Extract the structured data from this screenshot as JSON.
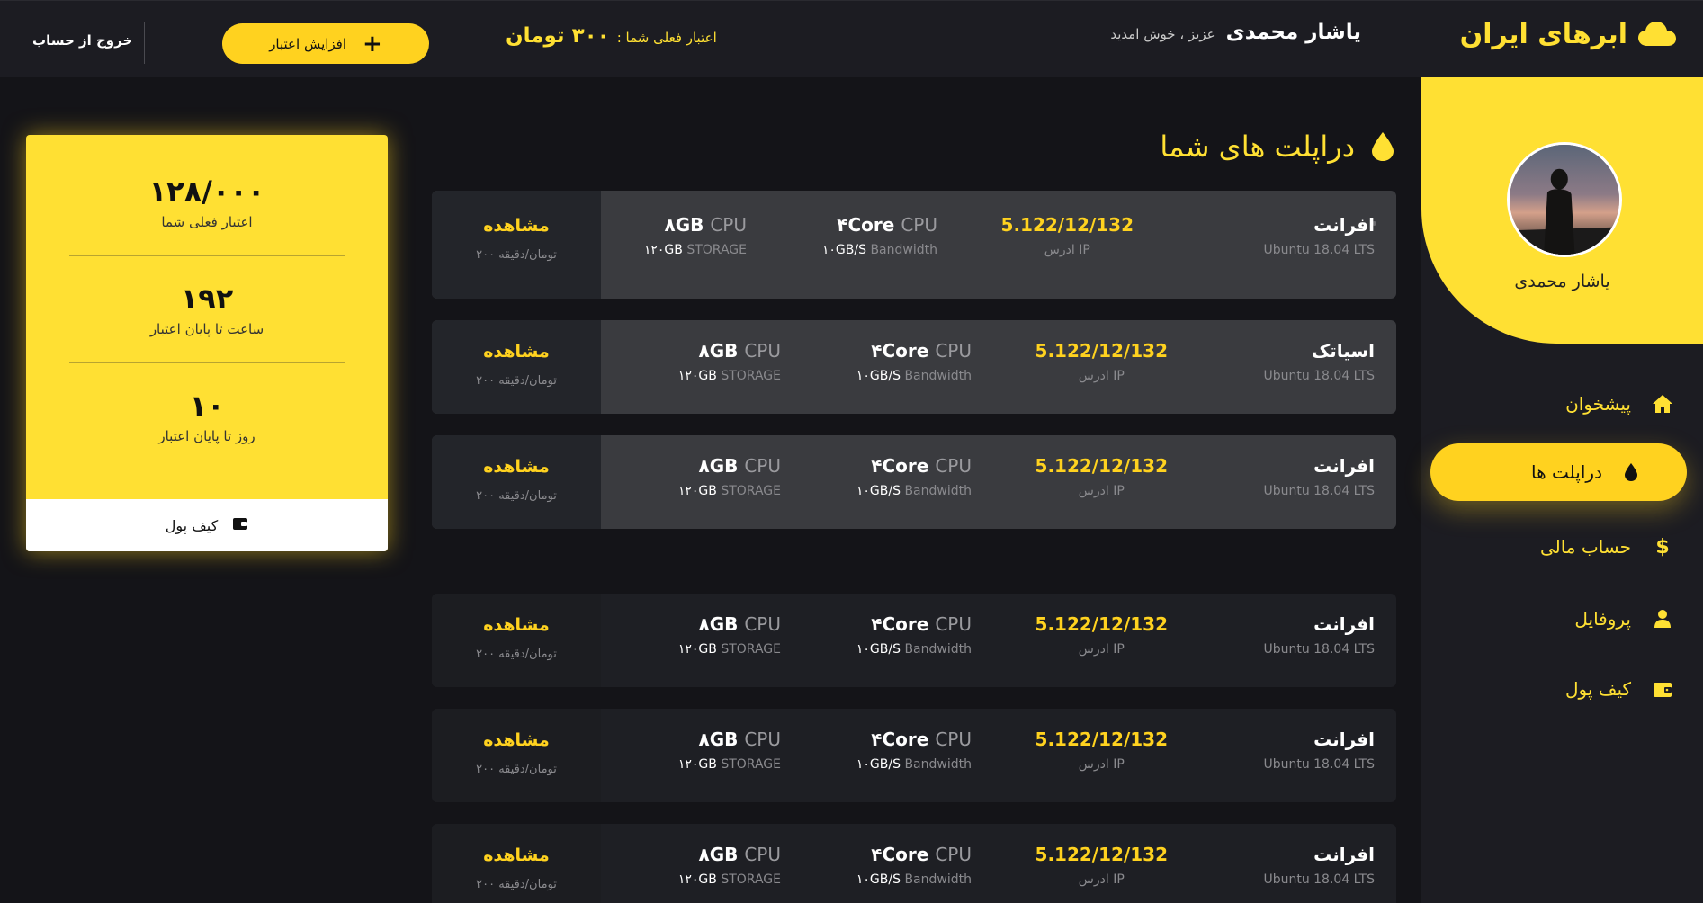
{
  "header": {
    "brand": "ابرهای ایران",
    "greeting_name": "یاشار محمدی",
    "greeting_sub": "عزیز ، خوش امدید",
    "credit_label": "اعتبار فعلی شما :",
    "credit_amount": "۳۰۰ تومان",
    "add_credit_label": "افزایش اعتبار",
    "logout_label": "خروج از حساب"
  },
  "sidebar": {
    "profile_name": "یاشار محمدی",
    "items": [
      {
        "label": "پیشخوان",
        "icon": "home-icon",
        "active": false
      },
      {
        "label": "دراپلت ها",
        "icon": "droplet-icon",
        "active": true
      },
      {
        "label": "حساب مالی",
        "icon": "dollar-icon",
        "active": false
      },
      {
        "label": "پروفایل",
        "icon": "user-icon",
        "active": false
      },
      {
        "label": "کیف پول",
        "icon": "wallet-icon",
        "active": false
      }
    ]
  },
  "main": {
    "title": "دراپلت های شما",
    "droplets": [
      {
        "name": "افرانت",
        "os": "Ubuntu 18.04 LTS",
        "ip": "5.122/12/132",
        "ip_label": "ادرس IP",
        "cpu_value": "۴Core",
        "cpu_unit": "CPU",
        "bw_value": "۱۰GB/S",
        "bw_label": "Bandwidth",
        "ram_value": "۸GB",
        "ram_unit": "CPU",
        "storage_value": "۱۲۰GB",
        "storage_label": "STORAGE",
        "view_label": "مشاهده",
        "price": "۲۰۰ تومان/دقیقه"
      },
      {
        "name": "اسیاتک",
        "os": "Ubuntu 18.04 LTS",
        "ip": "5.122/12/132",
        "ip_label": "ادرس IP",
        "cpu_value": "۴Core",
        "cpu_unit": "CPU",
        "bw_value": "۱۰GB/S",
        "bw_label": "Bandwidth",
        "ram_value": "۸GB",
        "ram_unit": "CPU",
        "storage_value": "۱۲۰GB",
        "storage_label": "STORAGE",
        "view_label": "مشاهده",
        "price": "۲۰۰ تومان/دقیقه"
      },
      {
        "name": "افرانت",
        "os": "Ubuntu 18.04 LTS",
        "ip": "5.122/12/132",
        "ip_label": "ادرس IP",
        "cpu_value": "۴Core",
        "cpu_unit": "CPU",
        "bw_value": "۱۰GB/S",
        "bw_label": "Bandwidth",
        "ram_value": "۸GB",
        "ram_unit": "CPU",
        "storage_value": "۱۲۰GB",
        "storage_label": "STORAGE",
        "view_label": "مشاهده",
        "price": "۲۰۰ تومان/دقیقه"
      },
      {
        "name": "افرانت",
        "os": "Ubuntu 18.04 LTS",
        "ip": "5.122/12/132",
        "ip_label": "ادرس IP",
        "cpu_value": "۴Core",
        "cpu_unit": "CPU",
        "bw_value": "۱۰GB/S",
        "bw_label": "Bandwidth",
        "ram_value": "۸GB",
        "ram_unit": "CPU",
        "storage_value": "۱۲۰GB",
        "storage_label": "STORAGE",
        "view_label": "مشاهده",
        "price": "۲۰۰ تومان/دقیقه"
      },
      {
        "name": "افرانت",
        "os": "Ubuntu 18.04 LTS",
        "ip": "5.122/12/132",
        "ip_label": "ادرس IP",
        "cpu_value": "۴Core",
        "cpu_unit": "CPU",
        "bw_value": "۱۰GB/S",
        "bw_label": "Bandwidth",
        "ram_value": "۸GB",
        "ram_unit": "CPU",
        "storage_value": "۱۲۰GB",
        "storage_label": "STORAGE",
        "view_label": "مشاهده",
        "price": "۲۰۰ تومان/دقیقه"
      },
      {
        "name": "افرانت",
        "os": "Ubuntu 18.04 LTS",
        "ip": "5.122/12/132",
        "ip_label": "ادرس IP",
        "cpu_value": "۴Core",
        "cpu_unit": "CPU",
        "bw_value": "۱۰GB/S",
        "bw_label": "Bandwidth",
        "ram_value": "۸GB",
        "ram_unit": "CPU",
        "storage_value": "۱۲۰GB",
        "storage_label": "STORAGE",
        "view_label": "مشاهده",
        "price": "۲۰۰ تومان/دقیقه"
      }
    ]
  },
  "stats": {
    "credit_value": "۱۲۸/۰۰۰",
    "credit_label": "اعتبار فعلی شما",
    "hours_value": "۱۹۲",
    "hours_label": "ساعت تا پایان اعتبار",
    "days_value": "۱۰",
    "days_label": "روز تا پایان اعتبار",
    "wallet_label": "کیف پول"
  },
  "colors": {
    "accent": "#ffe033",
    "button": "#ffd21f",
    "background": "#141418",
    "panel": "#1c1c22"
  }
}
